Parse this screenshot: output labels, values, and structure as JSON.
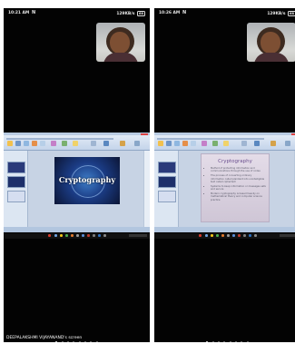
{
  "left_phone": {
    "status_bar": {
      "time": "10:21 AM",
      "mic": "N",
      "net": "129KB/s",
      "battery": "68"
    },
    "slide": {
      "title": "Cryptography"
    },
    "page_dots": {
      "count": 8,
      "active_index": 0
    },
    "screen_label": "DEEPALAKSHMI VIJAYANAND's screen"
  },
  "right_phone": {
    "status_bar": {
      "time": "10:26 AM",
      "mic": "N",
      "net": "129KB/s",
      "battery": "68"
    },
    "slide": {
      "title": "Cryptography",
      "bullets": [
        "Method of protecting information and communications through the use of codes",
        "The process of converting ordinary information called plaintext into unintelligible text called ciphertext",
        "Systems to keep information or messages safe and secure",
        "Modern cryptography is based heavily on mathematical theory and computer science practice"
      ]
    },
    "page_dots": {
      "count": 8,
      "active_index": 0
    }
  },
  "colors": {
    "background": "#ffffff",
    "phone": "#030303",
    "slide_dark": "#1b3c85",
    "slide_light_title": "#6b4f8f"
  },
  "icons": [
    "mic-icon",
    "battery-icon",
    "participant-video-thumbnail"
  ]
}
